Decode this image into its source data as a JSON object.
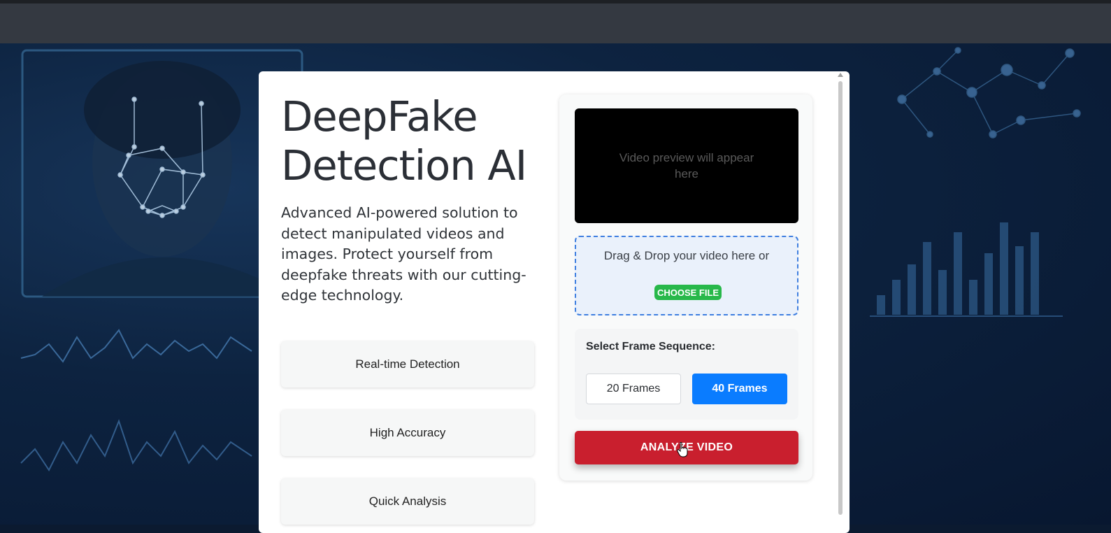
{
  "hero": {
    "title": "DeepFake Detection AI",
    "description": "Advanced AI-powered solution to detect manipulated videos and images. Protect yourself from deepfake threats with our cutting-edge technology."
  },
  "features": [
    {
      "label": "Real-time Detection"
    },
    {
      "label": "High Accuracy"
    },
    {
      "label": "Quick Analysis"
    }
  ],
  "upload": {
    "preview_placeholder": "Video preview will appear here",
    "drop_text": "Drag & Drop your video here or",
    "choose_label": "CHOOSE FILE"
  },
  "frames": {
    "label": "Select Frame Sequence:",
    "options": [
      "20 Frames",
      "40 Frames"
    ],
    "selected": "40 Frames"
  },
  "analyze_label": "ANALYZE VIDEO",
  "colors": {
    "accent_blue": "#0a7cff",
    "analyze_red": "#c91f2e",
    "choose_green": "#28b84a"
  }
}
